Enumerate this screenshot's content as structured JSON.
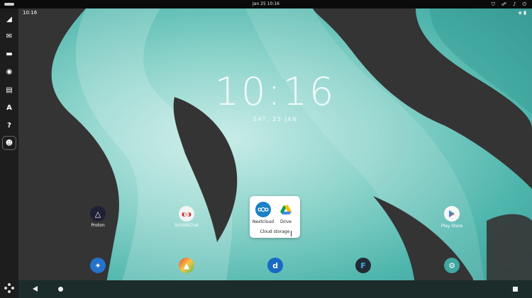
{
  "topbar": {
    "datetime": "Jan 25  10:16"
  },
  "dock": {
    "apps": [
      {
        "name": "browser",
        "color": "#2a8fd1"
      },
      {
        "name": "mail",
        "color": "#1e6fb5"
      },
      {
        "name": "files",
        "color": "#c34a4a"
      },
      {
        "name": "rhythmbox",
        "color": "#e0a21a"
      },
      {
        "name": "writer",
        "color": "#2c6fb3"
      },
      {
        "name": "software",
        "color": "#e2571e"
      },
      {
        "name": "help",
        "color": "#2a88d8"
      },
      {
        "name": "waydroid",
        "color": "#4a8a3c"
      }
    ]
  },
  "android": {
    "status_time": "10:16",
    "clock": "10:16",
    "date": "SAT, 25 JAN",
    "home_icons": [
      {
        "label": "Proton",
        "color": "#1f1f35"
      },
      {
        "label": "SchildiChat",
        "color": "#f4f4f4"
      },
      {
        "label": "Play Store",
        "color": "#f7f7f7"
      }
    ],
    "folder": {
      "name": "Cloud storage",
      "apps": [
        {
          "label": "Nextcloud",
          "color": "#1a82c4"
        },
        {
          "label": "Drive",
          "color": "#ffffff"
        }
      ]
    },
    "hotseat": [
      {
        "name": "compass",
        "color": "#2572c9"
      },
      {
        "name": "gallery",
        "color": "#e9a23b"
      },
      {
        "name": "dialer",
        "color": "#1769c4"
      },
      {
        "name": "ferdium",
        "color": "#222b35"
      },
      {
        "name": "settings",
        "color": "#3fa6a0"
      }
    ]
  }
}
